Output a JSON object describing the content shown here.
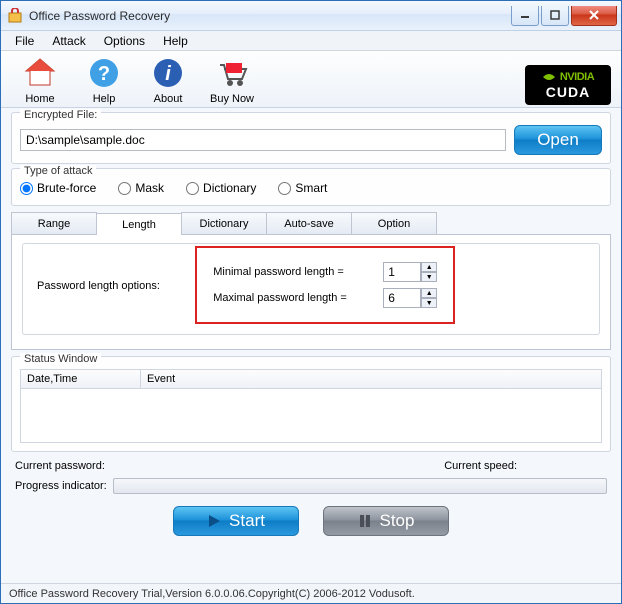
{
  "window": {
    "title": "Office Password Recovery"
  },
  "menus": {
    "file": "File",
    "attack": "Attack",
    "options": "Options",
    "help": "Help"
  },
  "toolbar": {
    "home": "Home",
    "help": "Help",
    "about": "About",
    "buynow": "Buy Now"
  },
  "cuda": {
    "brand": "NVIDIA",
    "name": "CUDA"
  },
  "file_group": {
    "label": "Encrypted File:",
    "path": "D:\\sample\\sample.doc",
    "open": "Open"
  },
  "attack_group": {
    "label": "Type of attack",
    "brute": "Brute-force",
    "mask": "Mask",
    "dictionary": "Dictionary",
    "smart": "Smart"
  },
  "tabs": {
    "range": "Range",
    "length": "Length",
    "dictionary": "Dictionary",
    "autosave": "Auto-save",
    "option": "Option"
  },
  "length_panel": {
    "legend": "Password length options:",
    "min_label": "Minimal password length  =",
    "min_value": "1",
    "max_label": "Maximal password length  =",
    "max_value": "6"
  },
  "status": {
    "legend": "Status Window",
    "col_date": "Date,Time",
    "col_event": "Event"
  },
  "info": {
    "current_password": "Current password:",
    "current_speed": "Current speed:",
    "progress": "Progress indicator:"
  },
  "actions": {
    "start": "Start",
    "stop": "Stop"
  },
  "statusbar": "Office Password Recovery Trial,Version 6.0.0.06.Copyright(C) 2006-2012 Vodusoft."
}
